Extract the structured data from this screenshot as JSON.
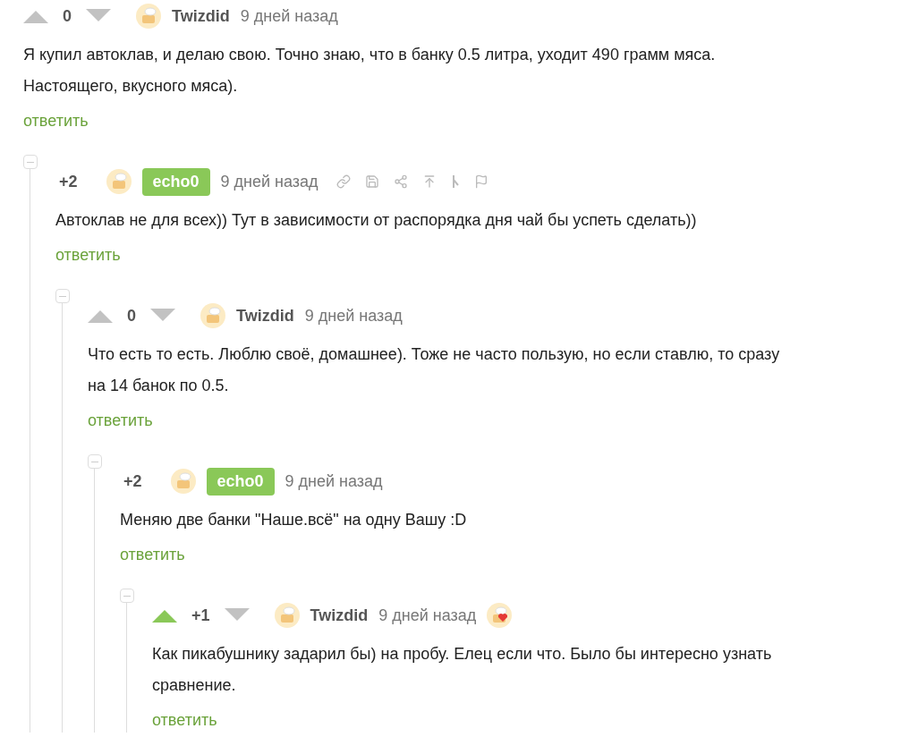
{
  "comment": {
    "votes": {
      "upvoted": false
    },
    "rating": "0",
    "author": "Twizdid",
    "author_highlighted": false,
    "time": "9 дней назад",
    "text": "Я купил автоклав, и делаю свою. Точно знаю, что в банку 0.5 литра, уходит 490 грамм мяса. Настоящего, вкусного мяса).",
    "reply": "ответить",
    "children": [
      {
        "rating": "+2",
        "author": "echo0",
        "author_highlighted": true,
        "time": "9 дней назад",
        "actions": [
          {
            "kind": "link"
          },
          {
            "kind": "save"
          },
          {
            "kind": "share"
          },
          {
            "kind": "top"
          },
          {
            "kind": "branch"
          },
          {
            "kind": "flag"
          }
        ],
        "text": "Автоклав не для всех)) Тут в зависимости от распорядка дня чай бы успеть сделать))",
        "reply": "ответить",
        "children": [
          {
            "votes": {
              "upvoted": false
            },
            "rating": "0",
            "author": "Twizdid",
            "author_highlighted": false,
            "time": "9 дней назад",
            "text": "Что есть то есть. Люблю своё, домашнее). Тоже не часто пользую, но если ставлю, то сразу на 14 банок по 0.5.",
            "reply": "ответить",
            "children": [
              {
                "rating": "+2",
                "author": "echo0",
                "author_highlighted": true,
                "time": "9 дней назад",
                "text": "Меняю две банки \"Наше.всё\" на одну Вашу :D",
                "reply": "ответить",
                "children": [
                  {
                    "votes": {
                      "upvoted": true
                    },
                    "rating": "+1",
                    "author": "Twizdid",
                    "author_highlighted": false,
                    "time": "9 дней назад",
                    "award": {
                      "kind": "heart"
                    },
                    "text": "Как пикабушнику задарил бы) на пробу. Елец если что. Было бы интересно узнать сравнение.",
                    "reply": "ответить"
                  }
                ]
              }
            ]
          }
        ]
      }
    ]
  }
}
